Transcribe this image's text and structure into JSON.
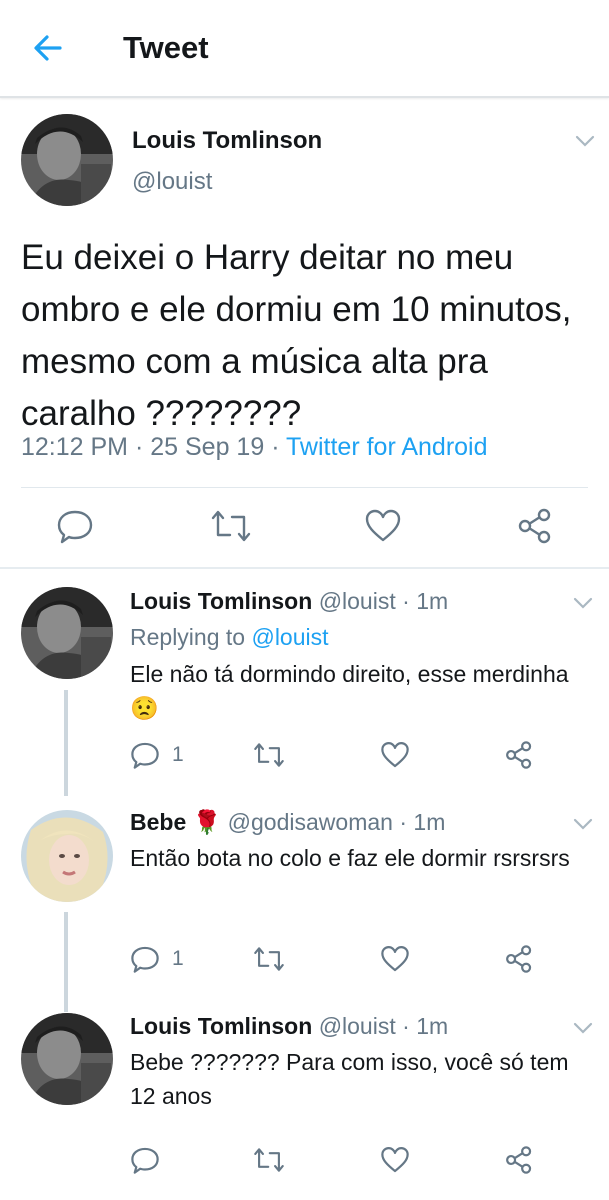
{
  "header": {
    "title": "Tweet",
    "back_icon": "arrow-left-icon",
    "accent": "#1da1f2"
  },
  "tweet": {
    "author_name": "Louis Tomlinson",
    "author_handle": "@louist",
    "text": "Eu deixei o Harry deitar no meu ombro e ele dormiu em 10 minutos, mesmo com a música alta pra caralho ????????",
    "time": "12:12 PM",
    "sep1": "·",
    "date": "25 Sep 19",
    "sep2": "·",
    "source": "Twitter for Android",
    "actions": [
      "reply-icon",
      "retweet-icon",
      "like-icon",
      "share-icon"
    ]
  },
  "replies": [
    {
      "name": "Louis Tomlinson",
      "handle": "@louist",
      "sep": "·",
      "time": "1m",
      "replying_prefix": "Replying to",
      "replying_handle": "@louist",
      "text": "Ele não tá dormindo direito, esse merdinha 😟",
      "reply_count": "1"
    },
    {
      "name": "Bebe",
      "name_emoji": "🌹",
      "handle": "@godisawoman",
      "sep": "·",
      "time": "1m",
      "text": "Então bota no colo e faz ele dormir rsrsrsrs",
      "reply_count": "1"
    },
    {
      "name": "Louis Tomlinson",
      "handle": "@louist",
      "sep": "·",
      "time": "1m",
      "text": "Bebe ??????? Para com isso, você só tem 12 anos"
    }
  ]
}
